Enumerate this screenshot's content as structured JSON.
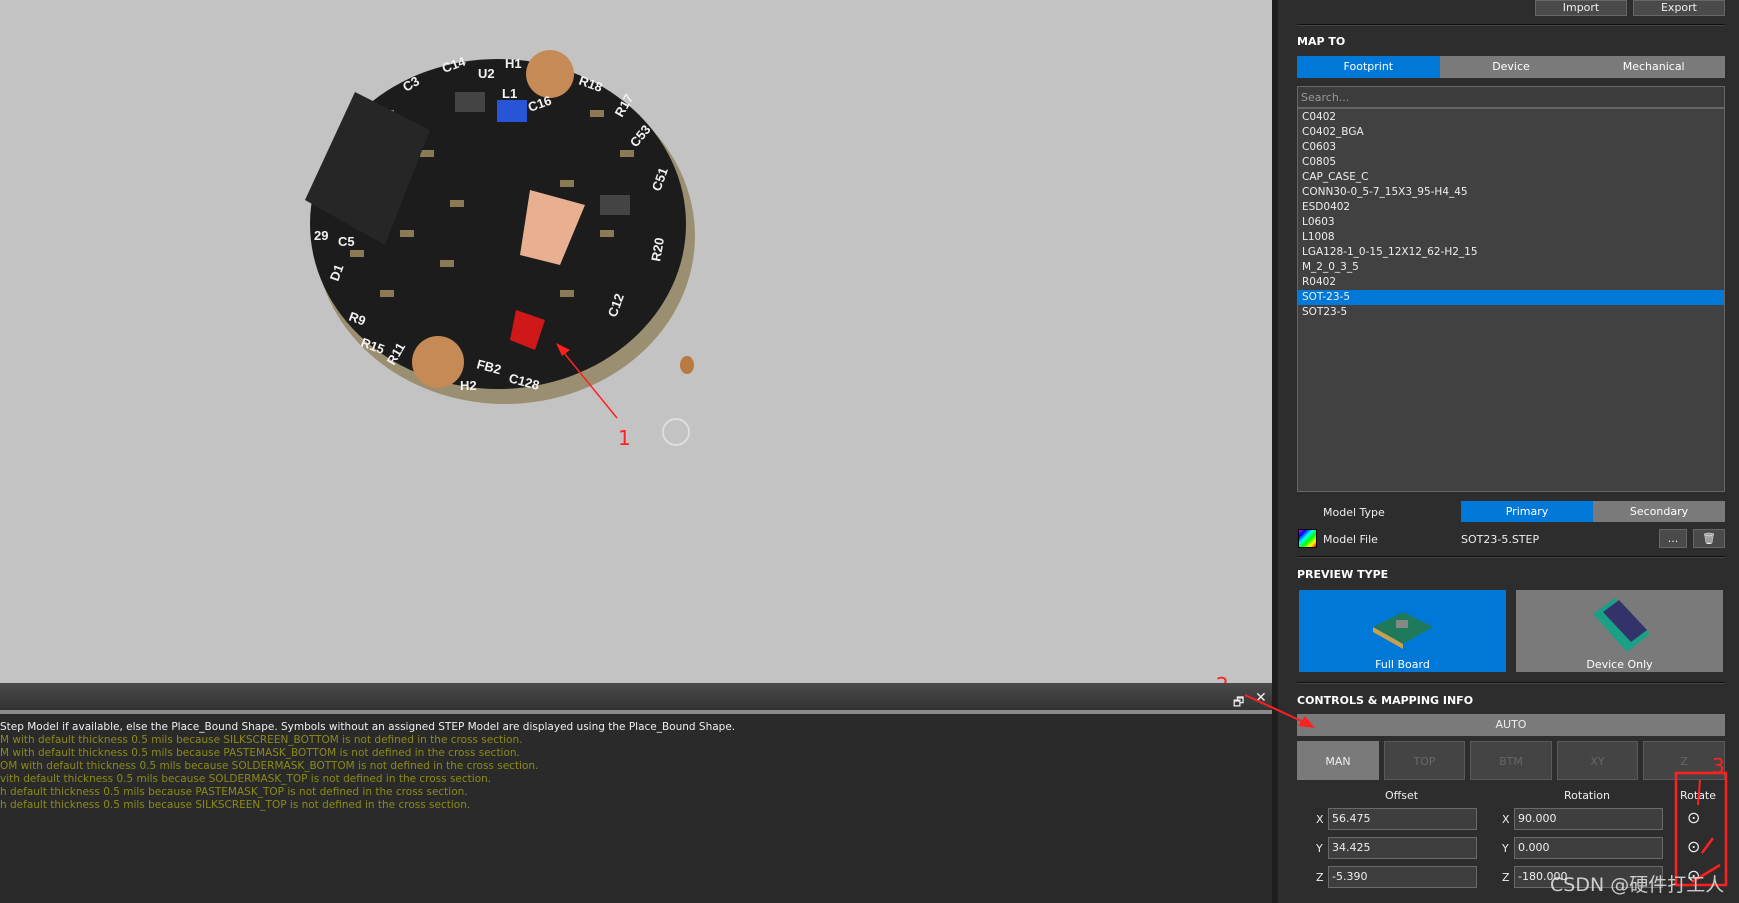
{
  "toolbar": {
    "import": "Import",
    "export": "Export"
  },
  "map_to": {
    "title": "MAP TO",
    "tabs": [
      "Footprint",
      "Device",
      "Mechanical"
    ],
    "active": "Footprint",
    "search_placeholder": "Search...",
    "items": [
      "C0402",
      "C0402_BGA",
      "C0603",
      "C0805",
      "CAP_CASE_C",
      "CONN30-0_5-7_15X3_95-H4_45",
      "ESD0402",
      "L0603",
      "L1008",
      "LGA128-1_0-15_12X12_62-H2_15",
      "M_2_0_3_5",
      "R0402",
      "SOT-23-5",
      "SOT23-5"
    ],
    "selected": "SOT-23-5"
  },
  "model": {
    "type_label": "Model Type",
    "types": [
      "Primary",
      "Secondary"
    ],
    "active": "Primary",
    "file_label": "Model File",
    "file": "SOT23-5.STEP",
    "browse": "..."
  },
  "preview": {
    "title": "PREVIEW TYPE",
    "full": "Full Board",
    "device": "Device Only",
    "active": "Full Board"
  },
  "controls": {
    "title": "CONTROLS & MAPPING INFO",
    "auto": "AUTO",
    "modes": [
      "MAN",
      "TOP",
      "BTM",
      "XY",
      "Z"
    ],
    "active_mode": "MAN",
    "offset_label": "Offset",
    "rotation_label": "Rotation",
    "rotate_label": "Rotate",
    "axes": [
      "X",
      "Y",
      "Z"
    ],
    "offset": {
      "x": "56.475",
      "y": "34.425",
      "z": "-5.390"
    },
    "rotation": {
      "x": "90.000",
      "y": "0.000",
      "z": "-180.000"
    }
  },
  "log": [
    "Step Model if available, else the Place_Bound Shape.  Symbols without an assigned STEP Model are displayed using the Place_Bound Shape.",
    "M with default thickness 0.5 mils because SILKSCREEN_BOTTOM is not defined in the cross section.",
    "M with default thickness 0.5 mils because PASTEMASK_BOTTOM is not defined in the cross section.",
    "OM with default thickness 0.5 mils because SOLDERMASK_BOTTOM is not defined in the cross section.",
    "vith default thickness 0.5 mils because SOLDERMASK_TOP is not defined in the cross section.",
    "h default thickness 0.5 mils because PASTEMASK_TOP is not defined in the cross section.",
    "h default thickness 0.5 mils because SILKSCREEN_TOP is not defined in the cross section."
  ],
  "annotations": {
    "a1": "1",
    "a2": "2",
    "a3": "3"
  },
  "pcb_labels": [
    "H1",
    "U2",
    "C14",
    "C3",
    "L1",
    "C16",
    "R18",
    "R17",
    "C53",
    "C51",
    "R20",
    "C12",
    "C128",
    "H2",
    "FB2",
    "R15",
    "R11",
    "R9",
    "D1",
    "C5",
    "29"
  ],
  "watermark": "CSDN @硬件打工人",
  "colors": {
    "accent": "#0078d7",
    "annotation": "#ff2020",
    "log_warning": "#8b8b18"
  }
}
